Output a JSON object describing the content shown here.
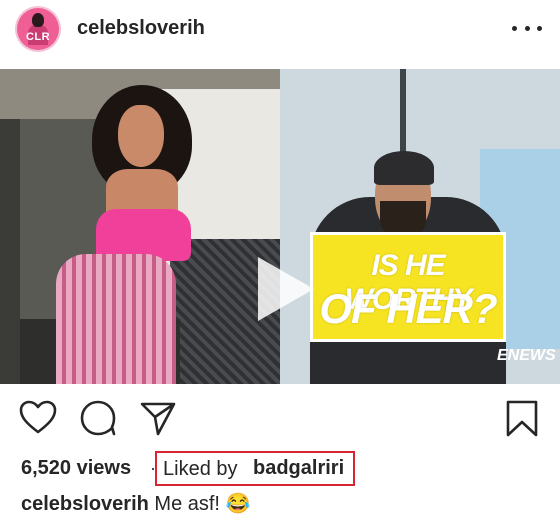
{
  "post": {
    "username": "celebsloverih",
    "avatar_text": "CLR"
  },
  "media": {
    "banner_line1": "IS HE WORTHY",
    "banner_line2": "OF HER?",
    "watermark": "ENEWS"
  },
  "stats": {
    "views": "6,520 views",
    "separator": "·",
    "liked_by_prefix": "Liked by",
    "liked_by_user": "badgalriri"
  },
  "caption": {
    "user": "celebsloverih",
    "text": "Me asf! 😂"
  },
  "colors": {
    "highlight": "#d7262f",
    "text": "#262626",
    "banner": "#f6e322"
  },
  "icons": [
    "heart-icon",
    "comment-icon",
    "share-icon",
    "bookmark-icon",
    "more-icon",
    "play-icon"
  ]
}
